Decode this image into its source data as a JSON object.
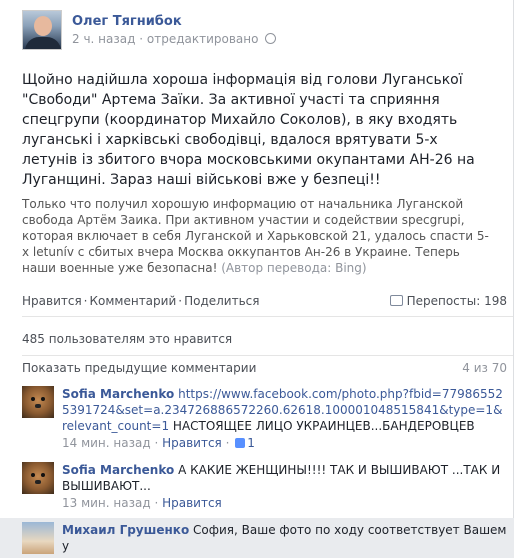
{
  "post": {
    "author": "Олег Тягнибок",
    "time": "2 ч. назад",
    "edited": "отредактировано",
    "text_uk": "Щойно надійшла хороша інформація від голови Луганської \"Свободи\" Артема Заїки. За активної участі та сприяння спецгрупи (координатор Михайло Соколов), в яку входять луганські і харківські свободівці, вдалося врятувати 5-х летунів із збитого вчора московськими окупантами АН-26 на Луганщині. Зараз наші військові вже у безпеці!!",
    "text_ru": "Только что получил хорошую информацию от начальника Луганской свобода Артём Заика. При активном участии и содействии specgrupi, которая включает в себя Луганской и Харьковской 21, удалось спасти 5-х letunív с сбитых вчера Москва оккупантов Ан-26 в Украине. Теперь наши военные уже безопасна!",
    "translation_note": "(Автор перевода: Bing)"
  },
  "actions": {
    "like": "Нравится",
    "comment": "Комментарий",
    "share": "Поделиться",
    "shares_label": "Перепосты: 198"
  },
  "likes_text": "485 пользователям это нравится",
  "comments_header": {
    "show_prev": "Показать предыдущие комментарии",
    "count": "4 из 70"
  },
  "comments": [
    {
      "name": "Sofia Marchenko",
      "link": "https://www.facebook.com/photo.php?fbid=779865525391724&set=a.234726886572260.62618.100001048515841&type=1&relevant_count=1",
      "text": "НАСТОЯЩЕЕ ЛИЦО УКРАИНЦЕВ...БАНДЕРОВЦЕВ",
      "time": "14 мин. назад",
      "like": "Нравится",
      "likes": "1"
    },
    {
      "name": "Sofia Marchenko",
      "text": "А КАКИЕ ЖЕНЩИНЫ!!!! ТАК И ВЫШИВАЮТ ...ТАК И ВЫШИВАЮТ...",
      "time": "13 мин. назад",
      "like": "Нравится"
    },
    {
      "name": "Михаил Грушенко",
      "text": "София, Ваше фото по ходу соответствует Вашему"
    }
  ]
}
